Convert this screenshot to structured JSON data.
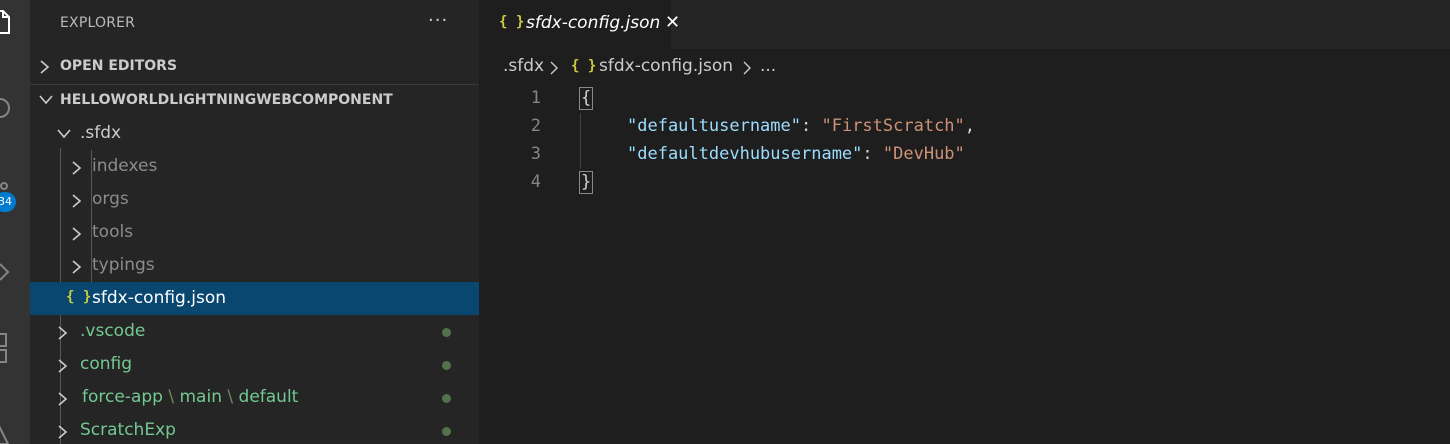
{
  "activity_bar": {
    "icons": [
      "files-icon",
      "search-icon",
      "source-control-icon",
      "run-debug-icon",
      "extensions-icon",
      "test-icon"
    ],
    "scm_badge": "34",
    "badge_color": "#007acc"
  },
  "sidebar": {
    "title": "EXPLORER",
    "more_label": "···",
    "open_editors": "OPEN EDITORS",
    "project": "HELLOWORLDLIGHTNINGWEBCOMPONENT",
    "tree": {
      "sfdx": ".sfdx",
      "indexes": "indexes",
      "orgs": "orgs",
      "tools": "tools",
      "typings": "typings",
      "config_file": "sfdx-config.json",
      "vscode": ".vscode",
      "config": "config",
      "force_app": "force-app",
      "main": "main",
      "default": "default",
      "scratch": "ScratchExp",
      "path_sep": "\\"
    },
    "modified_color": "#73c991",
    "selected_color": "#094771"
  },
  "editor": {
    "tab_label": "sfdx-config.json",
    "tab_close": "✕",
    "json_icon": "{ }",
    "breadcrumb": {
      "folder": ".sfdx",
      "file": "sfdx-config.json",
      "more": "..."
    },
    "lines": [
      "1",
      "2",
      "3",
      "4"
    ],
    "code": {
      "open_brace": "{",
      "key1": "\"defaultusername\"",
      "val1": "\"FirstScratch\"",
      "key2": "\"defaultdevhubusername\"",
      "val2": "\"DevHub\"",
      "close_brace": "}",
      "colon": ": ",
      "comma": ","
    }
  }
}
